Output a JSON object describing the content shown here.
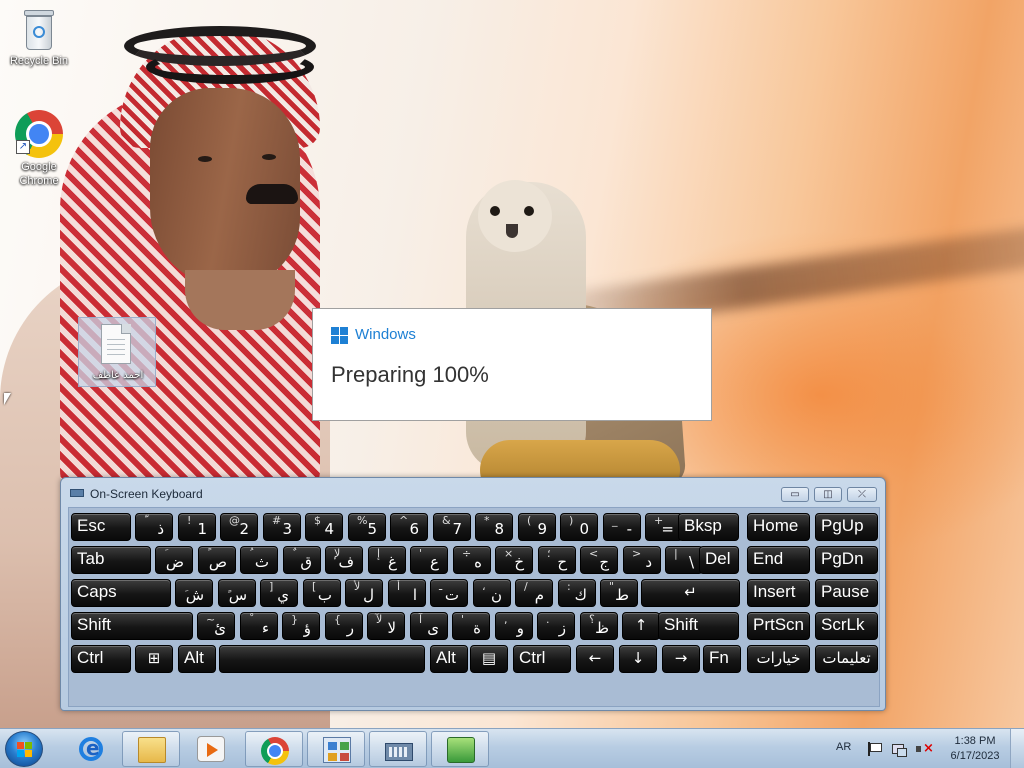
{
  "desktop": {
    "icons": [
      {
        "label": "Recycle Bin"
      },
      {
        "label": "Google Chrome"
      },
      {
        "label": "احمد عاطف"
      }
    ]
  },
  "dialog": {
    "brand": "Windows",
    "message": "Preparing 100%"
  },
  "osk": {
    "title": "On-Screen Keyboard",
    "buttons": {
      "minimize": "▭",
      "restore": "◫",
      "close": "⤫"
    },
    "rows": [
      [
        {
          "main": "Esc"
        },
        {
          "sub": "ّ",
          "big": "ذ"
        },
        {
          "sub": "!",
          "big": "1"
        },
        {
          "sub": "@",
          "big": "2"
        },
        {
          "sub": "#",
          "big": "3"
        },
        {
          "sub": "$",
          "big": "4"
        },
        {
          "sub": "%",
          "big": "5"
        },
        {
          "sub": "^",
          "big": "6"
        },
        {
          "sub": "&",
          "big": "7"
        },
        {
          "sub": "*",
          "big": "8"
        },
        {
          "sub": "(",
          "big": "9"
        },
        {
          "sub": ")",
          "big": "0"
        },
        {
          "sub": "_",
          "big": "-"
        },
        {
          "sub": "+",
          "big": "="
        },
        {
          "main": "Bksp"
        },
        {
          "main": "Home"
        },
        {
          "main": "PgUp"
        }
      ],
      [
        {
          "main": "Tab"
        },
        {
          "sub": "َ",
          "big": "ض"
        },
        {
          "sub": "ً",
          "big": "ص"
        },
        {
          "sub": "ُ",
          "big": "ث"
        },
        {
          "sub": "ٌ",
          "big": "ق"
        },
        {
          "sub": "لإ",
          "big": "ف"
        },
        {
          "sub": "إ",
          "big": "غ"
        },
        {
          "sub": "'",
          "big": "ع"
        },
        {
          "sub": "÷",
          "big": "ه"
        },
        {
          "sub": "×",
          "big": "خ"
        },
        {
          "sub": "؛",
          "big": "ح"
        },
        {
          "sub": "<",
          "big": "ج"
        },
        {
          "sub": ">",
          "big": "د"
        },
        {
          "sub": "|",
          "big": "\\"
        },
        {
          "main": "Del"
        },
        {
          "main": "End"
        },
        {
          "main": "PgDn"
        }
      ],
      [
        {
          "main": "Caps"
        },
        {
          "sub": "ِ",
          "big": "ش"
        },
        {
          "sub": "ٍ",
          "big": "س"
        },
        {
          "sub": "]",
          "big": "ي"
        },
        {
          "sub": "[",
          "big": "ب"
        },
        {
          "sub": "لأ",
          "big": "ل"
        },
        {
          "sub": "أ",
          "big": "ا"
        },
        {
          "sub": "ـ",
          "big": "ت"
        },
        {
          "sub": "،",
          "big": "ن"
        },
        {
          "sub": "/",
          "big": "م"
        },
        {
          "sub": ":",
          "big": "ك"
        },
        {
          "sub": "\"",
          "big": "ط"
        },
        {
          "main": "↵"
        },
        {
          "main": "Insert"
        },
        {
          "main": "Pause"
        }
      ],
      [
        {
          "main": "Shift"
        },
        {
          "sub": "~",
          "big": "ئ"
        },
        {
          "sub": "ْ",
          "big": "ء"
        },
        {
          "sub": "}",
          "big": "ؤ"
        },
        {
          "sub": "{",
          "big": "ر"
        },
        {
          "sub": "لآ",
          "big": "لا"
        },
        {
          "sub": "آ",
          "big": "ى"
        },
        {
          "sub": "'",
          "big": "ة"
        },
        {
          "sub": ",",
          "big": "و"
        },
        {
          "sub": ".",
          "big": "ز"
        },
        {
          "sub": "؟",
          "big": "ظ"
        },
        {
          "main": "↑"
        },
        {
          "main": "Shift"
        },
        {
          "main": "PrtScn"
        },
        {
          "main": "ScrLk"
        }
      ],
      [
        {
          "main": "Ctrl"
        },
        {
          "main": "⊞"
        },
        {
          "main": "Alt"
        },
        {
          "main": ""
        },
        {
          "main": "Alt"
        },
        {
          "main": "▤"
        },
        {
          "main": "Ctrl"
        },
        {
          "main": "←"
        },
        {
          "main": "↓"
        },
        {
          "main": "→"
        },
        {
          "main": "Fn"
        },
        {
          "main": "خيارات"
        },
        {
          "main": "تعليمات"
        }
      ]
    ]
  },
  "taskbar": {
    "items": [
      "start",
      "internet-explorer",
      "windows-explorer",
      "media-player",
      "google-chrome",
      "control-panel",
      "on-screen-keyboard",
      "setup"
    ],
    "language": "AR",
    "time": "1:38 PM",
    "date": "6/17/2023"
  },
  "colors": {
    "accent": "#1e80d4",
    "key_background": "#151515",
    "osk_frame": "#b7cbe1",
    "taskbar": "#b8cde3"
  }
}
